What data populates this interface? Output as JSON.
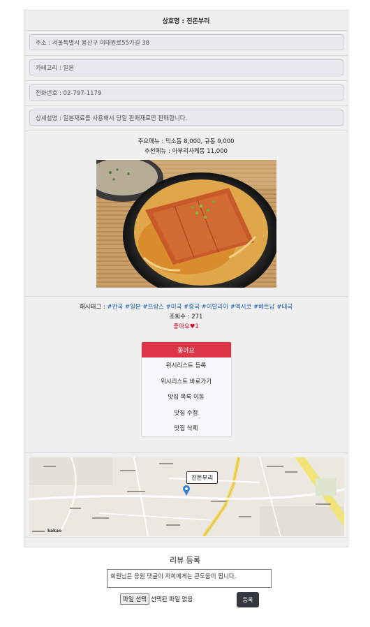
{
  "store": {
    "name_line": "상호명 : 진돈부리",
    "address": "주소 : 서울특별시 용산구 이태원로55가길 38",
    "category": "카테고리 : 일본",
    "phone": "전화번호 : 02-797-1179",
    "description": "상세설명 : 일본재료를 사용해서 당일 판매재료만 판매합니다.",
    "main_menu": "주요메뉴 : 믹소동 8,000, 규동 9,000",
    "recommended_menu": "추천메뉴 : 아부리사케동 11,000"
  },
  "info": {
    "hashtag_label": "해시태그 : ",
    "hashtags": [
      "#한국",
      "#일본",
      "#프랑스",
      "#미국",
      "#중국",
      "#이탈리아",
      "#멕시코",
      "#베트남",
      "#태국"
    ],
    "views": "조회수 : 271",
    "likes": "좋아요♥1"
  },
  "actions": {
    "like": "좋아요",
    "wishlist_add": "위시리스트 등록",
    "wishlist_go": "위시리스트 바로가기",
    "list_go": "맛집 목록 이동",
    "edit": "맛집 수정",
    "delete": "맛집 삭제"
  },
  "map": {
    "marker_label": "진돈부리",
    "logo": "kakao"
  },
  "review": {
    "title": "리뷰 등록",
    "placeholder": "회원님은 응원 댓글이 저희에게는 큰도움이 됩니다.",
    "file_button": "파일 선택",
    "file_status": "선택된 파일 없음",
    "submit": "등록"
  },
  "colors": {
    "like_button": "#dc3545",
    "submit_button": "#343a40",
    "hashtag": "#1a5fb4",
    "likes_text": "#d0021b"
  }
}
